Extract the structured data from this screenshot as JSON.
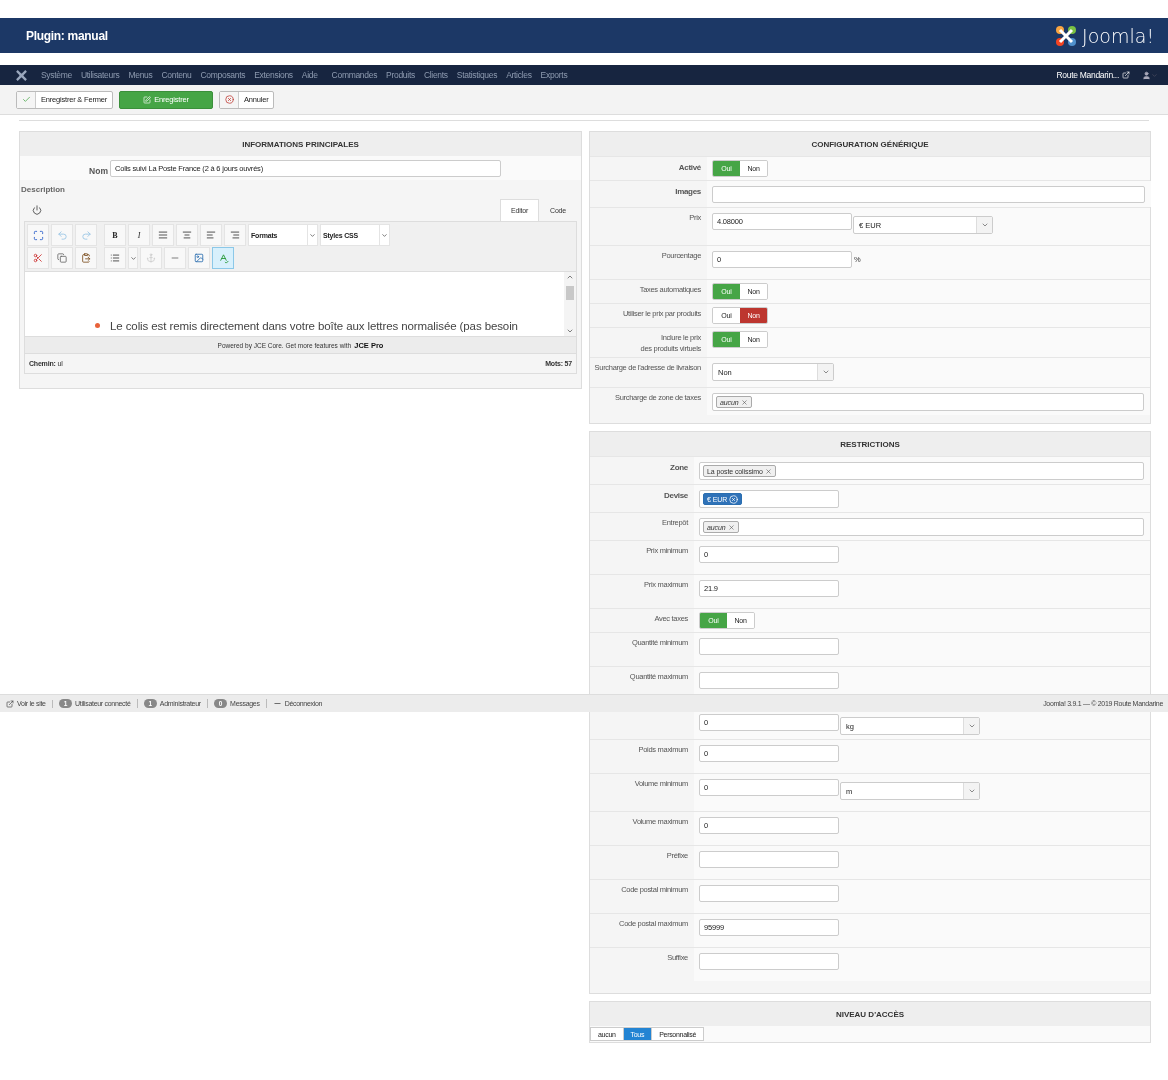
{
  "header": {
    "title": "Plugin: manual",
    "logo_text": "Joomla!"
  },
  "menu": {
    "groups": [
      {
        "items": [
          "Système",
          "Utilisateurs",
          "Menus",
          "Contenu",
          "Composants",
          "Extensions",
          "Aide"
        ]
      },
      {
        "items": [
          "Commandes",
          "Produits",
          "Clients",
          "Statistiques",
          "Articles",
          "Exports"
        ]
      }
    ],
    "user": "Route Mandarin..."
  },
  "toolbar": {
    "buttons": [
      {
        "label": "Enregistrer & Fermer",
        "kind": "save-close"
      },
      {
        "label": "Enregistrer",
        "kind": "save"
      },
      {
        "label": "Annuler",
        "kind": "cancel"
      }
    ]
  },
  "main_info": {
    "title": "INFORMATIONS PRINCIPALES",
    "name_label": "Nom",
    "name_value": "Colis suivi La Poste France (2 à 6 jours ouvrés)",
    "description_label": "Description",
    "editor": {
      "tabs": [
        {
          "label": "Editor",
          "selected": true
        },
        {
          "label": "Code",
          "selected": false
        }
      ],
      "bold_glyph": "B",
      "italic_glyph": "I",
      "formats": "Formats",
      "styles": "Styles CSS",
      "content": "Le colis est remis directement dans votre boîte aux lettres normalisée (pas besoin",
      "powered_text": "Powered by JCE Core. Get more features with",
      "powered_link": "JCE Pro",
      "path_label": "Chemin:",
      "path_value": "ul",
      "word_count": "Mots: 57"
    }
  },
  "config": {
    "title": "CONFIGURATION GÉNÉRIQUE",
    "fields": [
      {
        "label": "Activé",
        "emphasis": true,
        "kind": "toggle",
        "options": [
          {
            "label": "Oui",
            "selected": true
          },
          {
            "label": "Non",
            "selected": false
          }
        ]
      },
      {
        "label": "Images",
        "emphasis": true,
        "kind": "wide_input"
      },
      {
        "label": "Prix",
        "kind": "input_select",
        "value": "4.08000",
        "select": "€ EUR"
      },
      {
        "label": "Pourcentage",
        "kind": "input",
        "value": "0",
        "unit": "%"
      },
      {
        "label": "Taxes automatiques",
        "kind": "toggle",
        "options": [
          {
            "label": "Oui",
            "selected": true
          },
          {
            "label": "Non",
            "selected": false
          }
        ]
      },
      {
        "label": "Utiliser le prix par produits",
        "kind": "toggle",
        "options": [
          {
            "label": "Oui",
            "selected": false
          },
          {
            "label": "Non",
            "selected": true
          }
        ]
      },
      {
        "label": "Inclure le prix\ndes produits virtuels",
        "kind": "toggle",
        "options": [
          {
            "label": "Oui",
            "selected": true
          },
          {
            "label": "Non",
            "selected": false
          }
        ]
      },
      {
        "label": "Surcharge de l'adresse de livraison",
        "kind": "select",
        "select": "Non"
      },
      {
        "label": "Surcharge de zone de taxes",
        "kind": "tags",
        "tags": [
          {
            "label": "aucun",
            "kind": "empty"
          }
        ]
      }
    ]
  },
  "restrictions": {
    "title": "RESTRICTIONS",
    "fields": [
      {
        "label": "Zone",
        "emphasis": true,
        "kind": "tags",
        "tags": [
          {
            "label": "La poste colissimo",
            "kind": "value"
          }
        ]
      },
      {
        "label": "Devise",
        "emphasis": true,
        "kind": "chips",
        "tags": [
          {
            "label": "€ EUR",
            "kind": "chip"
          }
        ]
      },
      {
        "label": "Entrepôt",
        "kind": "tags",
        "tags": [
          {
            "label": "aucun",
            "kind": "empty"
          }
        ]
      },
      {
        "label": "Prix minimum",
        "kind": "input",
        "value": "0"
      },
      {
        "label": "Prix maximum",
        "kind": "input",
        "value": "21.9"
      },
      {
        "label": "Avec taxes",
        "kind": "toggle",
        "options": [
          {
            "label": "Oui",
            "selected": true
          },
          {
            "label": "Non",
            "selected": false
          }
        ]
      },
      {
        "label": "Quantité minimum",
        "kind": "input"
      },
      {
        "label": "Quantité maximum",
        "kind": "input"
      },
      {
        "kind": "input_select",
        "value": "0",
        "select": "kg"
      },
      {
        "label": "Poids maximum",
        "kind": "input",
        "value": "0"
      },
      {
        "label": "Volume minimum",
        "kind": "input_select",
        "value": "0",
        "select": "m"
      },
      {
        "label": "Volume maximum",
        "kind": "input",
        "value": "0"
      },
      {
        "label": "Préfixe",
        "kind": "input"
      },
      {
        "label": "Code postal minimum",
        "kind": "input"
      },
      {
        "label": "Code postal maximum",
        "kind": "input",
        "value": "95999"
      },
      {
        "label": "Suffixe",
        "kind": "input"
      }
    ]
  },
  "access": {
    "title": "NIVEAU D'ACCÈS",
    "options": [
      {
        "label": "aucun",
        "selected": false
      },
      {
        "label": "Tous",
        "selected": true
      },
      {
        "label": "Personnalisé",
        "selected": false
      }
    ]
  },
  "status_bar": {
    "items": [
      {
        "kind": "link",
        "label": "Voir le site"
      },
      {
        "kind": "count",
        "count": "1",
        "label": "Utilisateur connecté"
      },
      {
        "kind": "count",
        "count": "1",
        "label": "Administrateur"
      },
      {
        "kind": "count",
        "count": "0",
        "label": "Messages"
      },
      {
        "kind": "logout",
        "label": "Déconnexion"
      }
    ],
    "copyright": "Joomla! 3.9.1 — © 2019 Route Mandarine"
  }
}
